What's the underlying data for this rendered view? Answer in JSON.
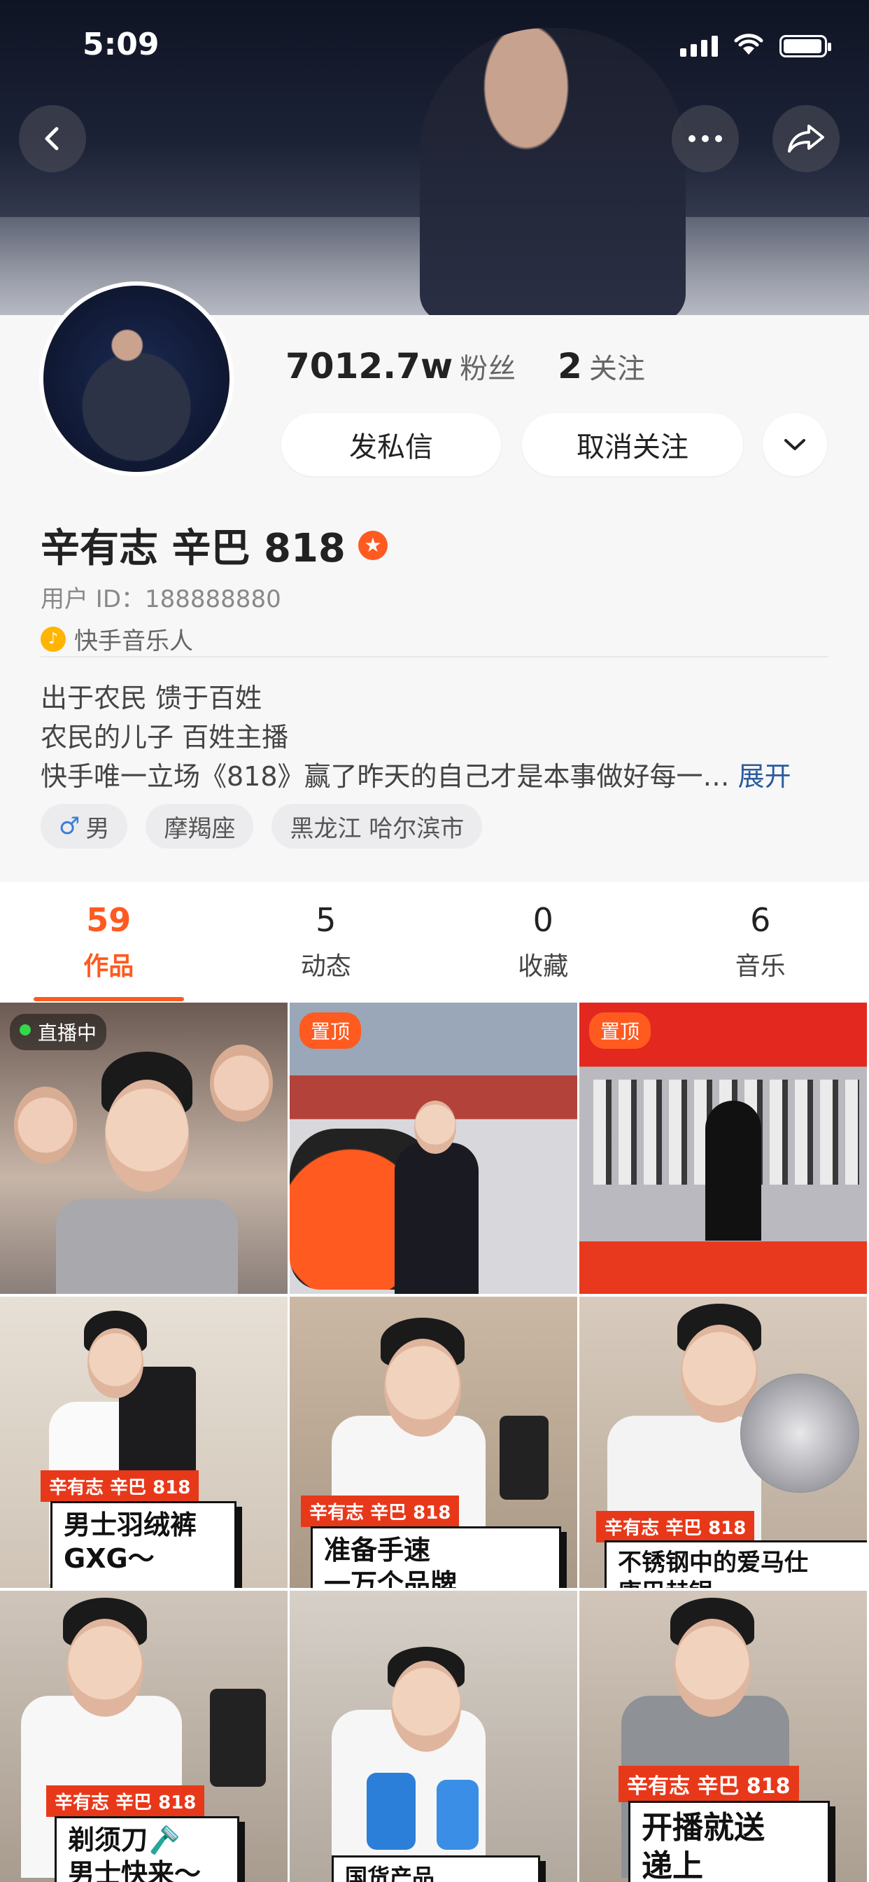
{
  "status_bar": {
    "time": "5:09"
  },
  "header": {
    "back_label": "‹",
    "more_label": "···",
    "share_label": "↪"
  },
  "profile": {
    "followers_count": "7012.7w",
    "followers_label": "粉丝",
    "following_count": "2",
    "following_label": "关注",
    "message_button": "发私信",
    "unfollow_button": "取消关注",
    "dropdown_icon": "chevron-down",
    "name": "辛有志 辛巴 818",
    "user_id": "用户 ID：188888880",
    "music_tag": "快手音乐人",
    "bio_lines": [
      "出于农民 馈于百姓",
      "农民的儿子  百姓主播",
      "快手唯一立场《818》赢了昨天的自己才是本事做好每一…"
    ],
    "expand_label": "展开",
    "tags": [
      "男",
      "摩羯座",
      "黑龙江 哈尔滨市"
    ]
  },
  "tabs": [
    {
      "count": "59",
      "label": "作品"
    },
    {
      "count": "5",
      "label": "动态"
    },
    {
      "count": "0",
      "label": "收藏"
    },
    {
      "count": "6",
      "label": "音乐"
    }
  ],
  "grid": {
    "live_badge": "直播中",
    "pinned_badge": "置顶",
    "shop_tag": "辛有志 辛巴 818",
    "captions": [
      "男士羽绒裤\nGXG～",
      "准备手速\n一万个品牌",
      "不锈钢中的爱马仕\n康巴赫锅",
      "剃须刀🪒\n男士快来～",
      "国货产品",
      "开播就送\n递上"
    ]
  },
  "colors": {
    "accent": "#ff5a1f",
    "link": "#2b5a9e"
  }
}
